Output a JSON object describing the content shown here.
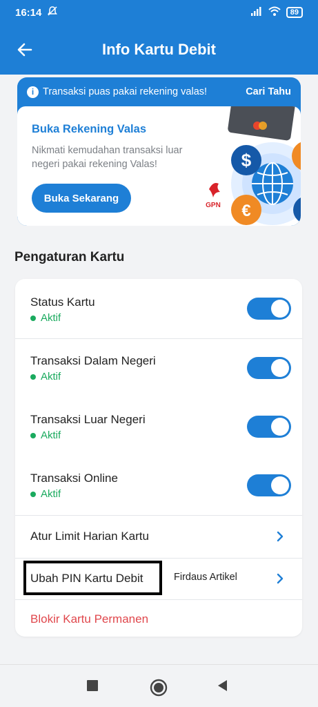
{
  "status_bar": {
    "time": "16:14",
    "battery": "89"
  },
  "app_bar": {
    "title": "Info Kartu Debit"
  },
  "promo": {
    "banner_text": "Transaksi puas pakai rekening valas!",
    "cari_tahu": "Cari Tahu",
    "title": "Buka Rekening Valas",
    "description": "Nikmati kemudahan transaksi luar negeri pakai rekening Valas!",
    "button": "Buka Sekarang",
    "gpn_logo": "GPN",
    "dollar_symbol": "$",
    "euro_symbol": "€"
  },
  "settings": {
    "section_title": "Pengaturan Kartu",
    "toggles": [
      {
        "label": "Status Kartu",
        "status": "Aktif",
        "on": true
      },
      {
        "label": "Transaksi Dalam Negeri",
        "status": "Aktif",
        "on": true
      },
      {
        "label": "Transaksi Luar Negeri",
        "status": "Aktif",
        "on": true
      },
      {
        "label": "Transaksi Online",
        "status": "Aktif",
        "on": true
      }
    ],
    "limit": {
      "label": "Atur Limit Harian Kartu"
    },
    "pin": {
      "label": "Ubah PIN Kartu Debit",
      "note": "Firdaus Artikel"
    },
    "block": {
      "label": "Blokir Kartu Permanen"
    }
  },
  "colors": {
    "primary": "#1e7fd6",
    "active": "#1aaa5e",
    "danger": "#e0474c"
  }
}
